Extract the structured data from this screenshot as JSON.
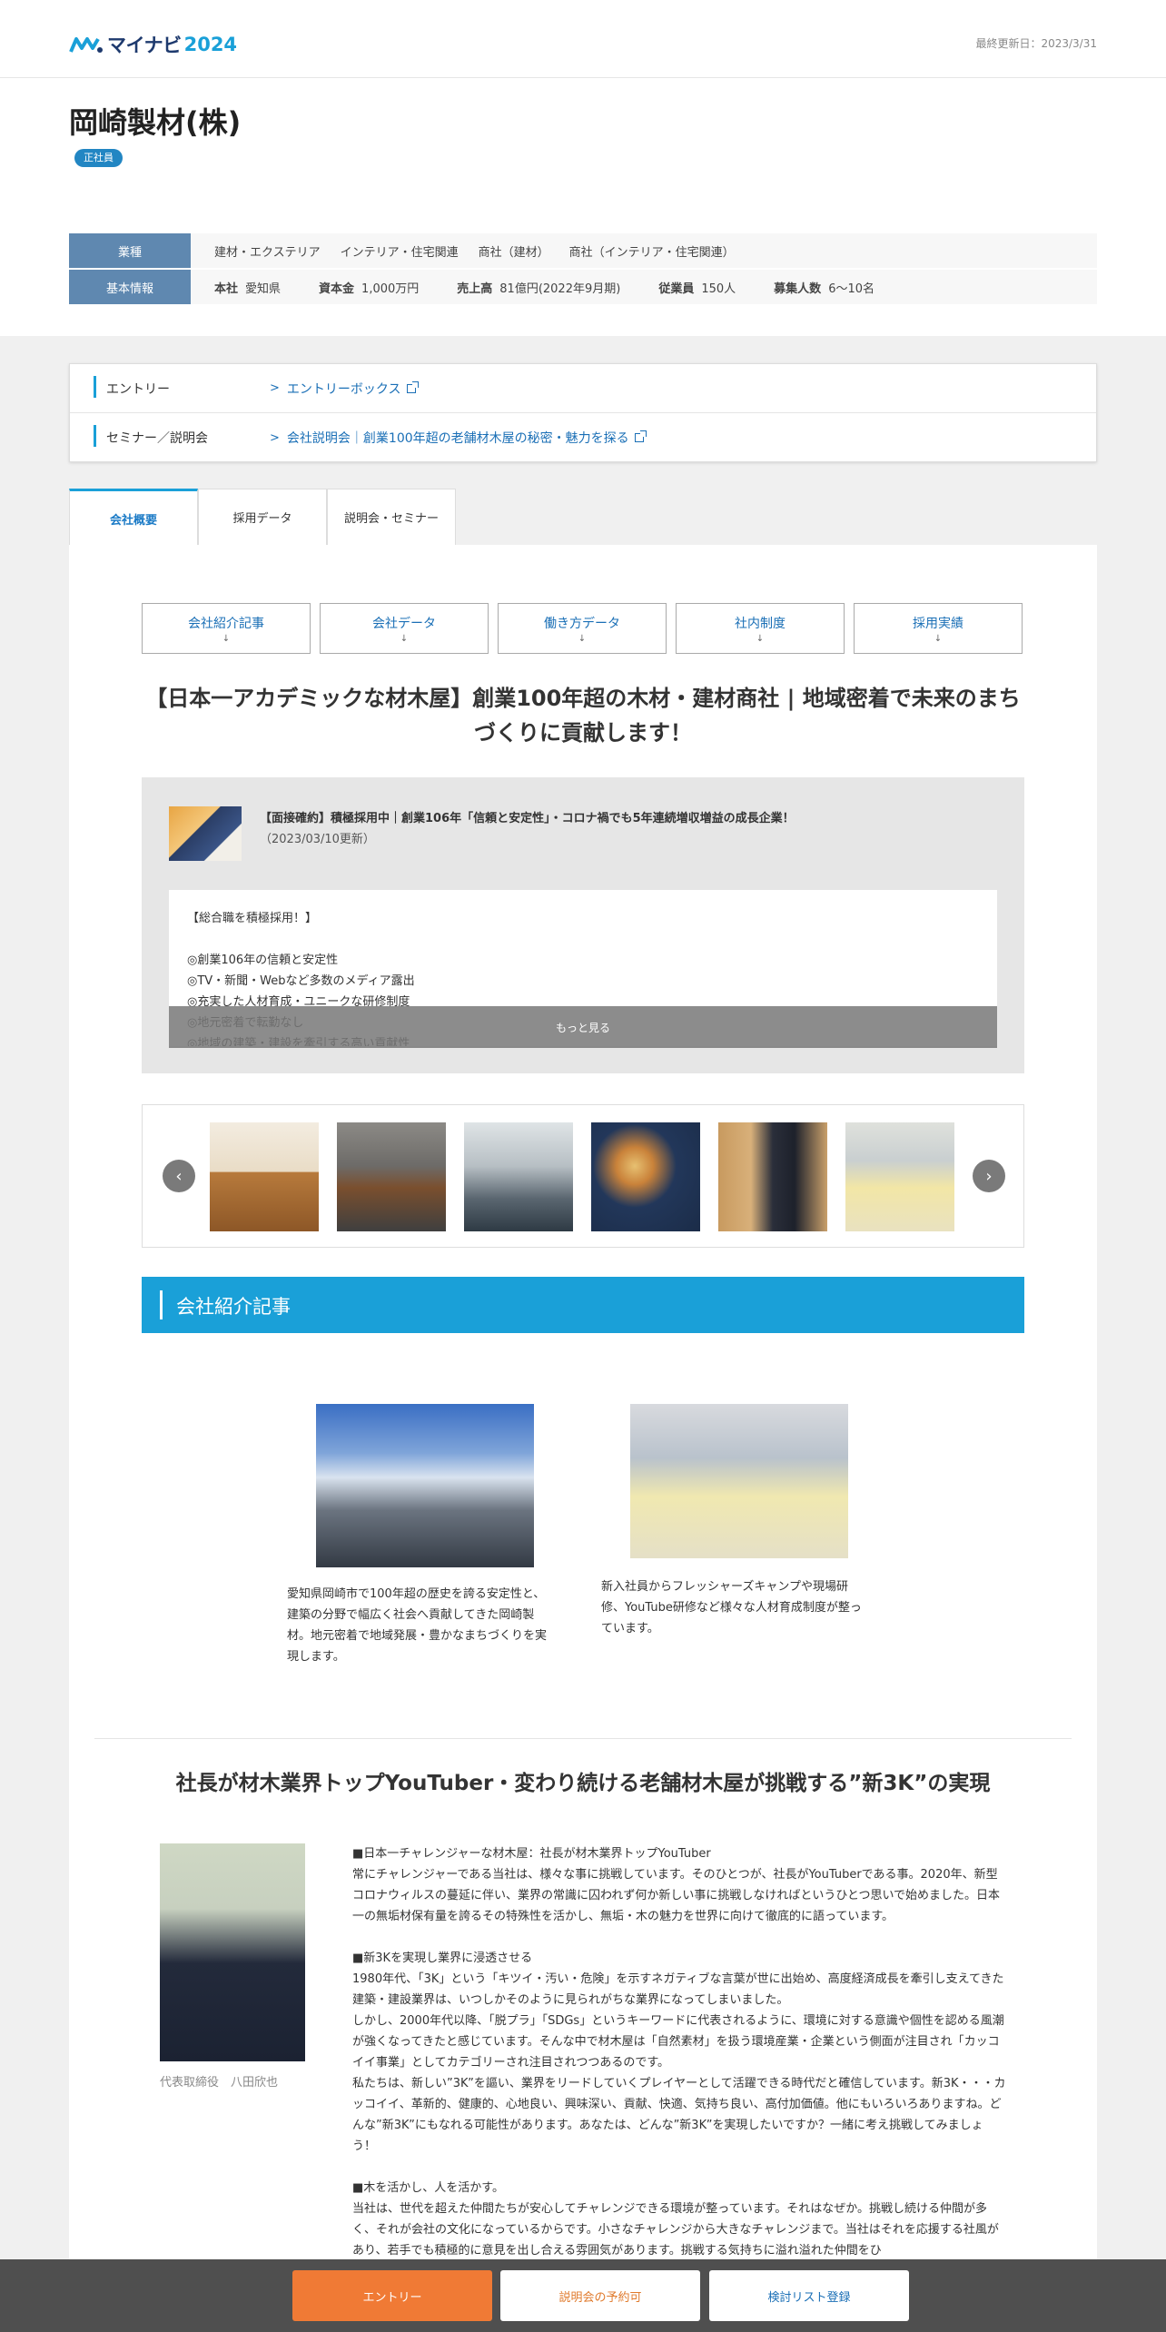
{
  "header": {
    "logo_text": "マイナビ",
    "logo_year": "2024",
    "updated": "最終更新日：2023/3/31"
  },
  "company": {
    "name": "岡崎製材(株)",
    "badge": "正社員"
  },
  "info": {
    "industry_label": "業種",
    "industries": [
      "建材・エクステリア",
      "インテリア・住宅関連",
      "商社（建材）",
      "商社（インテリア・住宅関連）"
    ],
    "basic_label": "基本情報",
    "basic": [
      {
        "key": "本社",
        "value": "愛知県"
      },
      {
        "key": "資本金",
        "value": "1,000万円"
      },
      {
        "key": "売上高",
        "value": "81億円(2022年9月期)"
      },
      {
        "key": "従業員",
        "value": "150人"
      },
      {
        "key": "募集人数",
        "value": "6～10名"
      }
    ]
  },
  "entry": {
    "rows": [
      {
        "label": "エントリー",
        "link": "エントリーボックス"
      },
      {
        "label": "セミナー／説明会",
        "link": "会社説明会｜創業100年超の老舗材木屋の秘密・魅力を探る"
      }
    ]
  },
  "tabs": [
    "会社概要",
    "採用データ",
    "説明会・セミナー"
  ],
  "anchor_nav": [
    "会社紹介記事",
    "会社データ",
    "働き方データ",
    "社内制度",
    "採用実績"
  ],
  "anchor_arrow": "↓",
  "headline": "【日本一アカデミックな材木屋】創業100年超の木材・建材商社 | 地域密着で未来のまちづくりに貢献します！",
  "news": {
    "title": "【面接確約】積極採用中｜創業106年「信頼と安定性」・コロナ禍でも5年連続増収増益の成長企業！",
    "date": "（2023/03/10更新）",
    "body": "【総合職を積極採用！】\n\n◎創業106年の信頼と安定性\n◎TV・新聞・Webなど多数のメディア露出\n◎充実した人材育成・ユニークな研修制度\n◎地元密着で転勤なし\n◎地域の建築・建設を牽引する高い貢献性",
    "more": "もっと見る"
  },
  "gallery": {
    "prev": "‹",
    "next": "›"
  },
  "section_intro": {
    "title": "会社紹介記事",
    "articles": [
      {
        "desc": "愛知県岡崎市で100年超の歴史を誇る安定性と、建築の分野で幅広く社会へ貢献してきた岡崎製材。地元密着で地域発展・豊かなまちづくりを実現します。"
      },
      {
        "desc": "新入社員からフレッシャーズキャンプや現場研修、YouTube研修など様々な人材育成制度が整っています。"
      }
    ]
  },
  "ceo": {
    "title": "社長が材木業界トップYouTuber・変わり続ける老舗材木屋が挑戦する”新3K”の実現",
    "caption": "代表取締役　八田欣也",
    "text": "■日本一チャレンジャーな材木屋：社長が材木業界トップYouTuber\n常にチャレンジャーである当社は、様々な事に挑戦しています。そのひとつが、社長がYouTuberである事。2020年、新型コロナウィルスの蔓延に伴い、業界の常識に囚われず何か新しい事に挑戦しなければというひとつ思いで始めました。日本一の無垢材保有量を誇るその特殊性を活かし、無垢・木の魅力を世界に向けて徹底的に語っています。\n\n■新3Kを実現し業界に浸透させる\n1980年代、「3K」という「キツイ・汚い・危険」を示すネガティブな言葉が世に出始め、高度経済成長を牽引し支えてきた建築・建設業界は、いつしかそのように見られがちな業界になってしまいました。\nしかし、2000年代以降、「脱プラ」「SDGs」というキーワードに代表されるように、環境に対する意識や個性を認める風潮が強くなってきたと感じています。そんな中で材木屋は「自然素材」を扱う環境産業・企業という側面が注目され「カッコイイ事業」としてカテゴリーされ注目されつつあるのです。\n私たちは、新しい”3K”を謳い、業界をリードしていくプレイヤーとして活躍できる時代だと確信しています。新3K・・・カッコイイ、革新的、健康的、心地良い、興味深い、貢献、快適、気持ち良い、高付加価値。他にもいろいろありますね。どんな”新3K”にもなれる可能性があります。あなたは、どんな”新3K”を実現したいですか？一緒に考え挑戦してみましょう！\n\n■木を活かし、人を活かす。\n当社は、世代を超えた仲間たちが安心してチャレンジできる環境が整っています。それはなぜか。挑戦し続ける仲間が多く、それが会社の文化になっているからです。小さなチャレンジから大きなチャレンジまで。当社はそれを応援する社風があり、若手でも積極的に意見を出し合える雰囲気があります。挑戦する気持ちに溢れ溢れた仲間をひ"
  },
  "footer": {
    "entry": "エントリー",
    "seminar": "説明会の予約可",
    "list": "検討リスト登録"
  },
  "colors": {
    "accent": "#1aa0d8",
    "info_head": "#5f88b0",
    "entry_button": "#f07a35"
  }
}
